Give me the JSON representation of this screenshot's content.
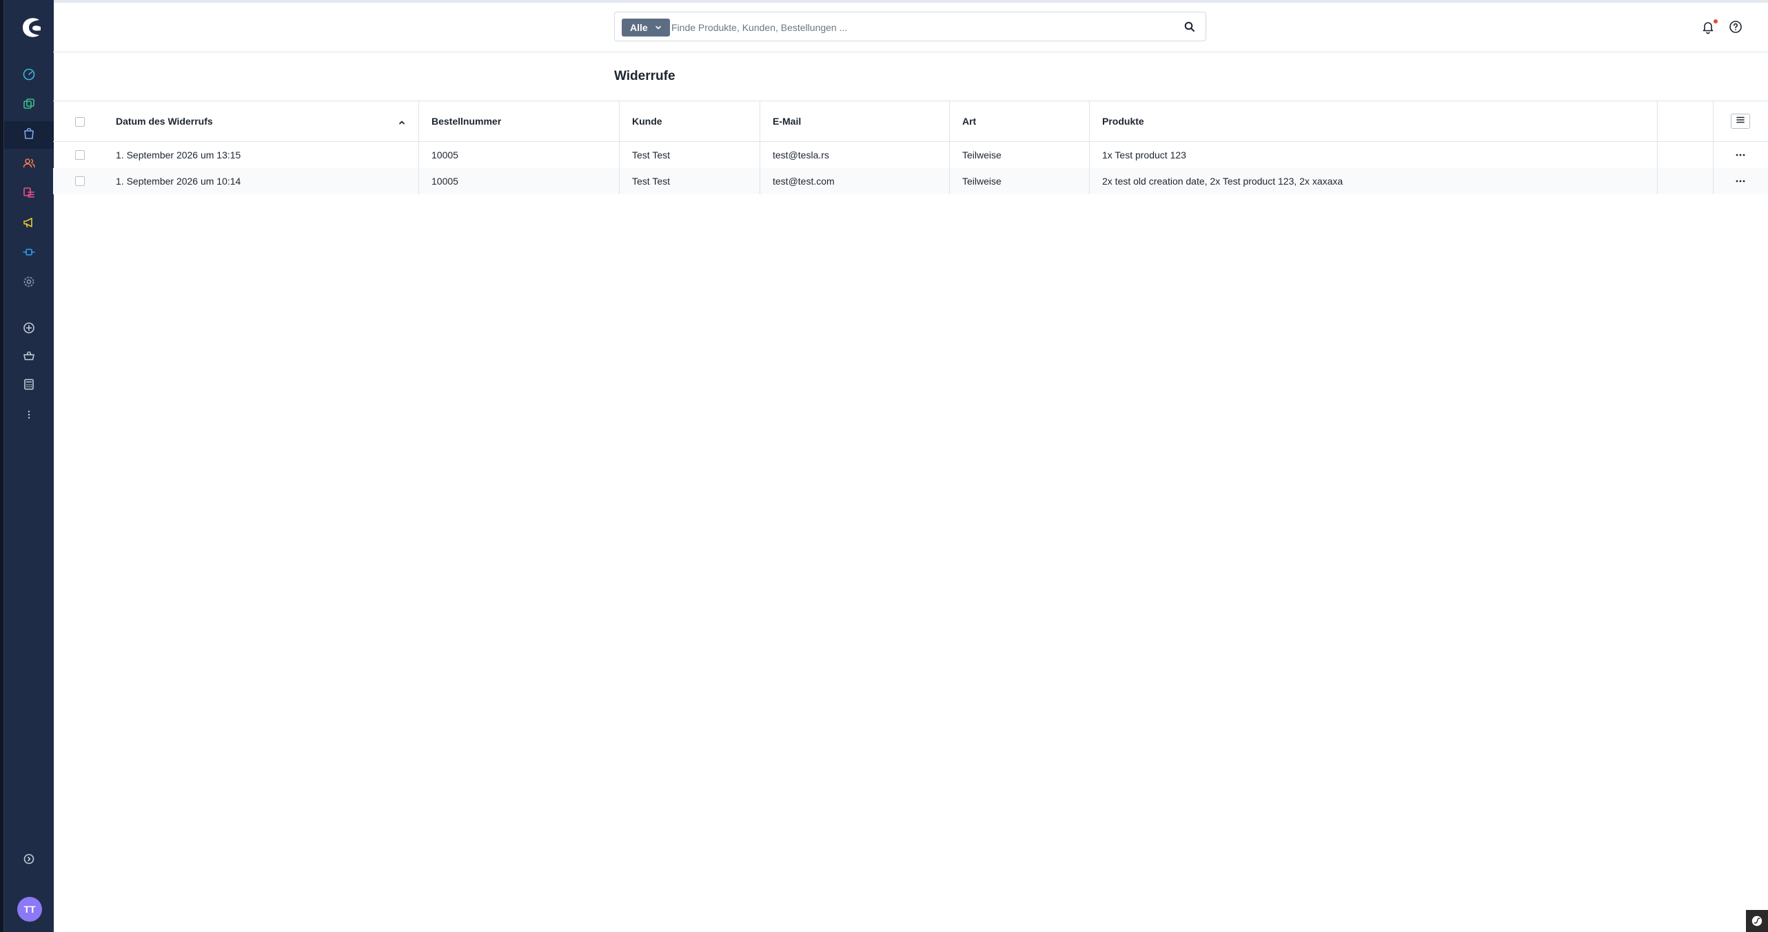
{
  "colors": {
    "sidebar_bg": "#1f2c47",
    "accent": "#5c6d83",
    "notification_dot": "#e24a3a",
    "avatar_bg": "#8c79f5"
  },
  "sidebar": {
    "logo_icon": "shopware-logo-icon",
    "items": [
      {
        "name": "dashboard",
        "icon": "gauge-icon"
      },
      {
        "name": "catalogues",
        "icon": "products-icon"
      },
      {
        "name": "orders",
        "icon": "shopping-bag-icon",
        "active": true
      },
      {
        "name": "customers",
        "icon": "users-icon"
      },
      {
        "name": "content",
        "icon": "content-icon"
      },
      {
        "name": "marketing",
        "icon": "megaphone-icon"
      },
      {
        "name": "extensions",
        "icon": "plug-icon"
      },
      {
        "name": "settings",
        "icon": "gear-icon"
      },
      {
        "name": "add",
        "icon": "plus-circle-icon"
      },
      {
        "name": "shop",
        "icon": "basket-icon"
      },
      {
        "name": "calculator",
        "icon": "calculator-icon"
      },
      {
        "name": "more",
        "icon": "more-vertical-icon"
      },
      {
        "name": "help",
        "icon": "help-circle-icon"
      }
    ],
    "user_initials": "TT"
  },
  "header": {
    "search": {
      "type_label": "Alle",
      "placeholder": "Finde Produkte, Kunden, Bestellungen ..."
    }
  },
  "page": {
    "title": "Widerrufe"
  },
  "table": {
    "columns": [
      "Datum des Widerrufs",
      "Bestellnummer",
      "Kunde",
      "E-Mail",
      "Art",
      "Produkte"
    ],
    "sort": {
      "column": "Datum des Widerrufs",
      "direction": "ascending"
    },
    "rows": [
      {
        "date": "1. September 2026 um 13:15",
        "order_number": "10005",
        "customer": "Test Test",
        "email": "test@tesla.rs",
        "type": "Teilweise",
        "products": "1x Test product 123"
      },
      {
        "date": "1. September 2026 um 10:14",
        "order_number": "10005",
        "customer": "Test Test",
        "email": "test@test.com",
        "type": "Teilweise",
        "products": "2x test old creation date, 2x Test product 123, 2x xaxaxa"
      }
    ]
  }
}
